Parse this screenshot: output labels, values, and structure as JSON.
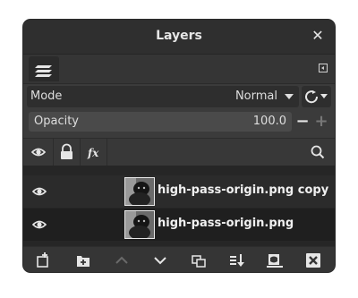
{
  "dialog": {
    "title": "Layers",
    "close_icon": "close-icon"
  },
  "tabs": {
    "active_icon": "layers-stack-icon",
    "menu_icon": "tab-menu-icon"
  },
  "mode": {
    "label": "Mode",
    "value": "Normal",
    "composite_icon": "composite-mode-icon"
  },
  "opacity": {
    "label": "Opacity",
    "value": "100.0",
    "decrease_symbol": "−",
    "increase_symbol": "+"
  },
  "header": {
    "icons": [
      "visibility-icon",
      "lock-icon",
      "fx-icon",
      "search-icon"
    ],
    "fx_label": "fx"
  },
  "layers": [
    {
      "name": "high-pass-origin.png copy",
      "visible": true
    },
    {
      "name": "high-pass-origin.png",
      "visible": true
    }
  ],
  "footer_buttons": [
    "new-layer-icon",
    "new-layer-group-icon",
    "raise-layer-icon",
    "lower-layer-icon",
    "duplicate-layer-icon",
    "merge-down-icon",
    "add-mask-icon",
    "delete-layer-icon"
  ],
  "colors": {
    "panel_bg": "#3b3b3b",
    "titlebar_bg": "#2f2f2f",
    "text": "#e6e6e6",
    "selected_row": "#2b2b2b"
  }
}
